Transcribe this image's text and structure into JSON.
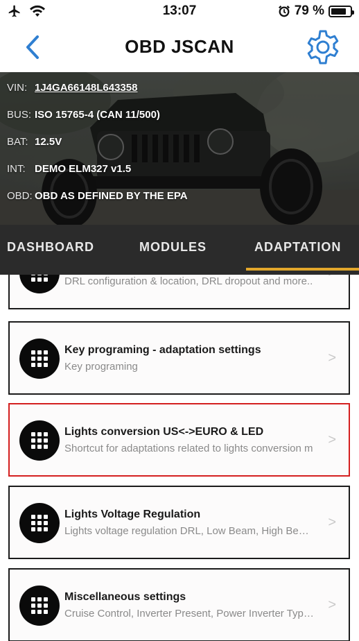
{
  "status_bar": {
    "time": "13:07",
    "battery_percent": "79 %",
    "battery_level": 0.79,
    "icons": [
      "airplane-icon",
      "wifi-icon",
      "alarm-icon",
      "battery-icon"
    ]
  },
  "nav": {
    "title": "OBD JSCAN",
    "back_icon": "chevron-left-icon",
    "settings_icon": "gear-icon",
    "accent": "#2f7fd1"
  },
  "vehicle": {
    "rows": [
      {
        "label": "VIN:",
        "value": "1J4GA66148L643358"
      },
      {
        "label": "BUS:",
        "value": "ISO 15765-4 (CAN 11/500)"
      },
      {
        "label": "BAT:",
        "value": "12.5V"
      },
      {
        "label": "INT:",
        "value": "DEMO ELM327 v1.5"
      },
      {
        "label": "OBD:",
        "value": "OBD AS DEFINED BY THE EPA"
      }
    ]
  },
  "tabs": {
    "items": [
      {
        "label": "DASHBOARD"
      },
      {
        "label": "MODULES"
      },
      {
        "label": "ADAPTATION"
      }
    ],
    "active": "ADAPTATION",
    "active_color": "#e2a72b"
  },
  "list": {
    "items": [
      {
        "title": "",
        "subtitle": "DRL configuration & location, DRL dropout and more.."
      },
      {
        "title": "Key programing - adaptation settings",
        "subtitle": "Key programing"
      },
      {
        "title": "Lights conversion US<->EURO & LED",
        "subtitle": "Shortcut for adaptations related to lights conversion m",
        "selected": true
      },
      {
        "title": "Lights Voltage Regulation",
        "subtitle": "Lights voltage regulation DRL, Low Beam, High Beam.."
      },
      {
        "title": "Miscellaneous settings",
        "subtitle": "Cruise Control, Inverter Present, Power Inverter Type a"
      }
    ],
    "chevron": ">",
    "icon": "grid-menu-icon",
    "selected_color": "#d41f1f"
  }
}
